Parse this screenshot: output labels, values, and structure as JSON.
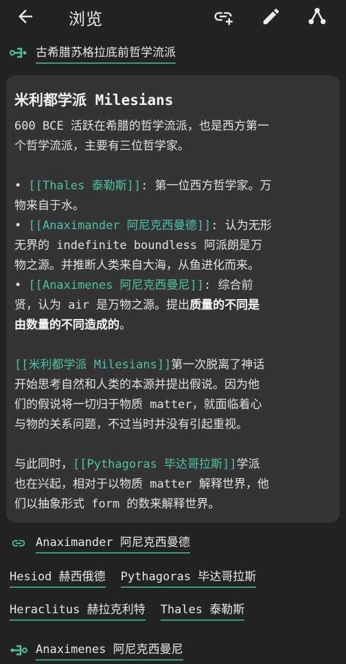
{
  "topbar": {
    "title": "浏览"
  },
  "parent": {
    "label": "古希腊苏格拉底前哲学流派"
  },
  "note": {
    "title": "米利都学派 Milesians",
    "intro": [
      "600 BCE 活跃在希腊的哲学流派，也是西方第一",
      "个哲学流派，主要有三位哲学家。"
    ],
    "b1_pre": "• ",
    "b1_link": "[[Thales 泰勒斯]]",
    "b1_rest": ": 第一位西方哲学家。万",
    "b1_l2": "物来自于水。",
    "b2_pre": "• ",
    "b2_link": "[[Anaximander 阿尼克西曼德]]",
    "b2_rest": ": 认为无形",
    "b2_l2": "无界的 indefinite boundless 阿派朗是万",
    "b2_l3": "物之源。并推断人类来自大海，从鱼进化而来。",
    "b3_pre": "• ",
    "b3_link": "[[Anaximenes 阿尼克西曼尼]]",
    "b3_rest": ": 综合前",
    "b3_l2_pre": "贤，认为 air 是万物之源。提出",
    "b3_l2_bold": "质量的不同是",
    "b3_l3_bold": "由数量的不同造成的",
    "b3_l3_end": "。",
    "p2_link": "[[米利都学派 Milesians]]",
    "p2_l1_rest": "第一次脱离了神话",
    "p2_l2": "开始思考自然和人类的本源并提出假说。因为他",
    "p2_l3": "们的假说将一切归于物质 matter，就面临着心",
    "p2_l4": "与物的关系问题，不过当时并没有引起重视。",
    "p3_pre": "与此同时，",
    "p3_link": "[[Pythagoras 毕达哥拉斯]]",
    "p3_rest": "学派",
    "p3_l2": "也在兴起，相对于以物质 matter 解释世界，他",
    "p3_l3": "们以抽象形式 form 的数来解释世界。"
  },
  "links": {
    "next_label": "Anaximander 阿尼克西曼德",
    "tags": [
      "Hesiod 赫西俄德",
      "Pythagoras 毕达哥拉斯",
      "Heraclitus 赫拉克利特",
      "Thales 泰勒斯"
    ],
    "child_label": "Anaximenes 阿尼克西曼尼"
  },
  "colors": {
    "accent": "#4fc3a4",
    "background": "#222322",
    "card": "#333433"
  },
  "icons": [
    "back-arrow-icon",
    "link-add-icon",
    "pencil-icon",
    "graph-icon",
    "parent-link-icon",
    "link-icon",
    "child-link-icon"
  ]
}
